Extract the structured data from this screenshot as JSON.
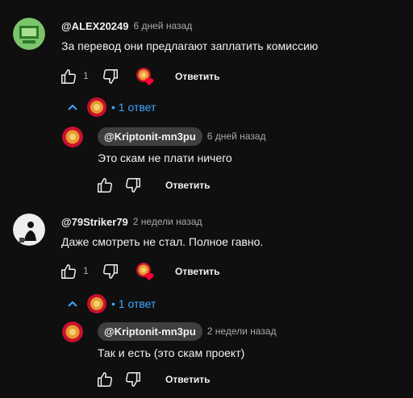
{
  "threads": [
    {
      "author": "@ALEX20249",
      "time": "6 дней назад",
      "text": "За перевод они предлагают заплатить комиссию",
      "likes": "1",
      "reply_label": "Ответить",
      "replies_toggle": "1 ответ",
      "reply": {
        "author": "@Kriptonit-mn3pu",
        "time": "6 дней назад",
        "text": "Это скам не плати ничего",
        "reply_label": "Ответить"
      }
    },
    {
      "author": "@79Striker79",
      "time": "2 недели назад",
      "text": "Даже смотреть не стал. Полное гавно.",
      "likes": "1",
      "reply_label": "Ответить",
      "replies_toggle": "1 ответ",
      "reply": {
        "author": "@Kriptonit-mn3pu",
        "time": "2 недели назад",
        "text": "Так и есть (это скам проект)",
        "reply_label": "Ответить"
      }
    }
  ],
  "colors": {
    "background": "#0f0f0f",
    "link_blue": "#3ea6ff",
    "heart_red": "#ff0033",
    "muted": "#aaaaaa"
  },
  "icons": [
    "like-icon",
    "dislike-icon",
    "creator-heart-icon",
    "chevron-up-icon"
  ]
}
